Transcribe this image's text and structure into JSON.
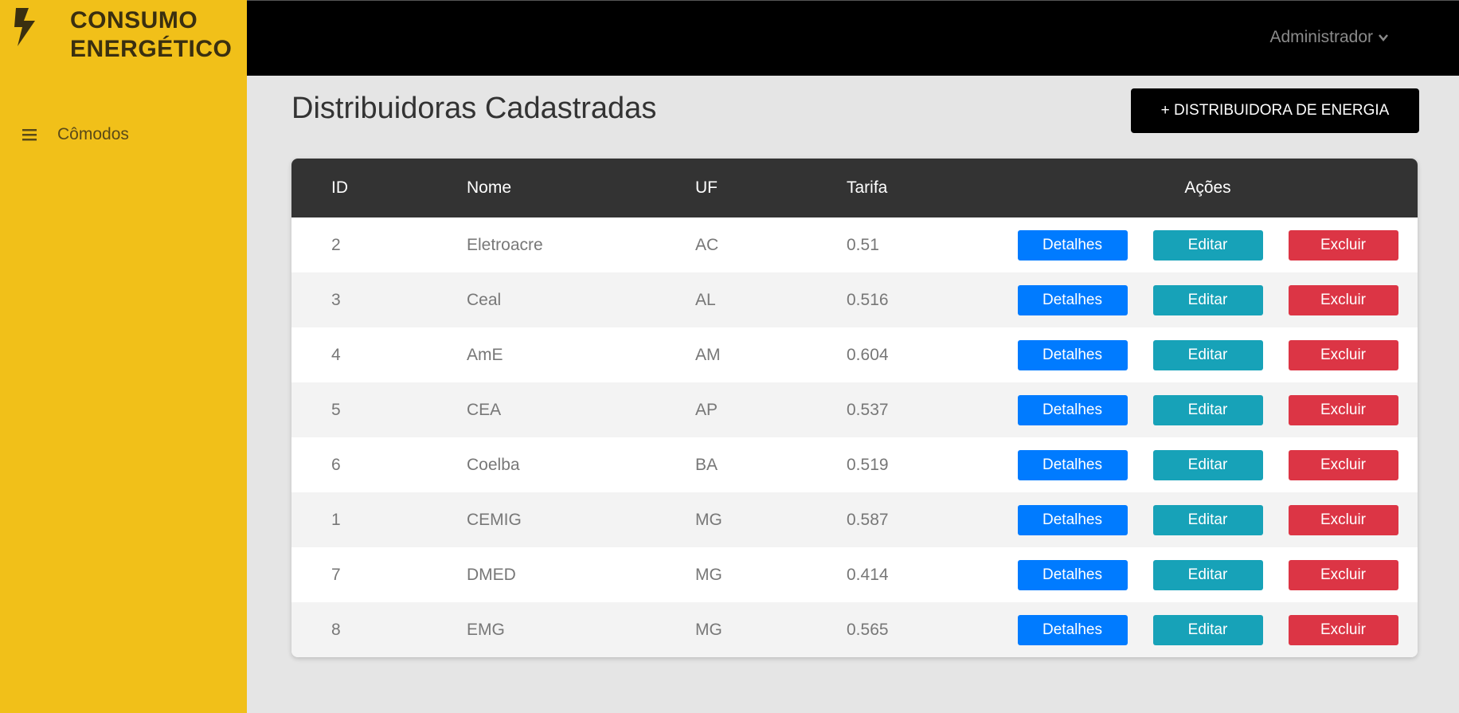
{
  "brand": {
    "line1": "CONSUMO",
    "line2": "ENERGÉTICO",
    "icon": "lightning-bolt-icon",
    "color": "#f1c019"
  },
  "header": {
    "user_label": "Administrador",
    "user_icon": "chevron-down-icon"
  },
  "sidebar": {
    "items": [
      {
        "label": "Cômodos",
        "icon": "menu-icon"
      }
    ]
  },
  "main": {
    "title": "Distribuidoras Cadastradas",
    "add_button": "+ DISTRIBUIDORA DE ENERGIA",
    "table": {
      "headers": {
        "id": "ID",
        "nome": "Nome",
        "uf": "UF",
        "tarifa": "Tarifa",
        "acoes": "Ações"
      },
      "actions": {
        "details": "Detalhes",
        "edit": "Editar",
        "delete": "Excluir"
      },
      "rows": [
        {
          "id": "2",
          "nome": "Eletroacre",
          "uf": "AC",
          "tarifa": "0.51"
        },
        {
          "id": "3",
          "nome": "Ceal",
          "uf": "AL",
          "tarifa": "0.516"
        },
        {
          "id": "4",
          "nome": "AmE",
          "uf": "AM",
          "tarifa": "0.604"
        },
        {
          "id": "5",
          "nome": "CEA",
          "uf": "AP",
          "tarifa": "0.537"
        },
        {
          "id": "6",
          "nome": "Coelba",
          "uf": "BA",
          "tarifa": "0.519"
        },
        {
          "id": "1",
          "nome": "CEMIG",
          "uf": "MG",
          "tarifa": "0.587"
        },
        {
          "id": "7",
          "nome": "DMED",
          "uf": "MG",
          "tarifa": "0.414"
        },
        {
          "id": "8",
          "nome": "EMG",
          "uf": "MG",
          "tarifa": "0.565"
        }
      ]
    }
  },
  "colors": {
    "details": "#007bff",
    "edit": "#17a2b8",
    "delete": "#dc3545",
    "header_bg": "#000000",
    "table_header": "#333333"
  }
}
